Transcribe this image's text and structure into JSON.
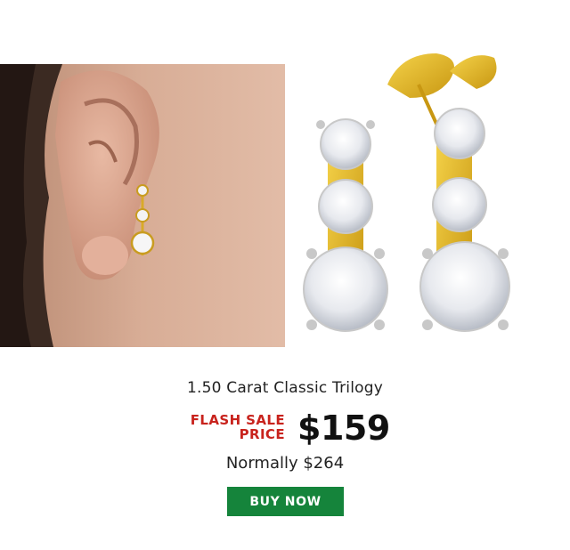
{
  "product": {
    "title": "1.50 Carat Classic Trilogy",
    "flash_label_line1": "FLASH SALE",
    "flash_label_line2": "PRICE",
    "sale_price": "$159",
    "normal_price": "Normally $264",
    "cta_label": "BUY NOW"
  },
  "colors": {
    "flash_red": "#c8231d",
    "button_green": "#15843b",
    "gold": "#e2b514"
  },
  "images": {
    "left": "ear-with-earring-photo",
    "right": "gold-trilogy-earrings-photo"
  }
}
